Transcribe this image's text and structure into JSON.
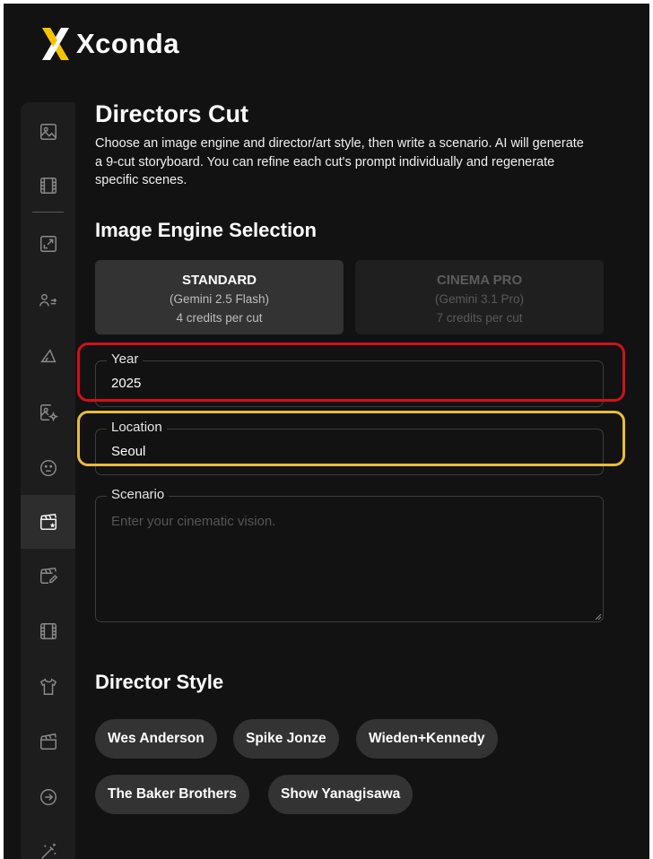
{
  "app": {
    "name": "Xconda",
    "logo_color": "#f5c400"
  },
  "sidebar": {
    "items": [
      {
        "icon": "image-icon"
      },
      {
        "icon": "film-icon"
      },
      {
        "icon": "expand-image-icon"
      },
      {
        "icon": "people-swap-icon"
      },
      {
        "icon": "triangle-angle-icon"
      },
      {
        "icon": "image-sparkle-icon"
      },
      {
        "icon": "face-icon"
      },
      {
        "icon": "clapperboard-star-icon",
        "active": true
      },
      {
        "icon": "clapperboard-edit-icon"
      },
      {
        "icon": "film-strip-icon"
      },
      {
        "icon": "tshirt-icon"
      },
      {
        "icon": "clapperboard-icon"
      },
      {
        "icon": "arrow-circle-right-icon"
      },
      {
        "icon": "magic-wand-icon"
      }
    ]
  },
  "page": {
    "title": "Directors Cut",
    "description": "Choose an image engine and director/art style, then write a scenario. AI will generate a 9-cut storyboard. You can refine each cut's prompt individually and regenerate specific scenes."
  },
  "engine_section": {
    "title": "Image Engine Selection",
    "options": [
      {
        "name": "STANDARD",
        "model": "(Gemini 2.5 Flash)",
        "cost": "4 credits per cut",
        "selected": true
      },
      {
        "name": "CINEMA PRO",
        "model": "(Gemini 3.1 Pro)",
        "cost": "7 credits per cut",
        "selected": false
      }
    ]
  },
  "form": {
    "year": {
      "label": "Year",
      "value": "2025"
    },
    "location": {
      "label": "Location",
      "value": "Seoul"
    },
    "scenario": {
      "label": "Scenario",
      "placeholder": "Enter your cinematic vision."
    }
  },
  "director_section": {
    "title": "Director Style",
    "styles": [
      "Wes Anderson",
      "Spike Jonze",
      "Wieden+Kennedy",
      "The Baker Brothers",
      "Show Yanagisawa"
    ]
  },
  "annotation_colors": {
    "year_box": "#d0111b",
    "location_box": "#e8bd38"
  }
}
